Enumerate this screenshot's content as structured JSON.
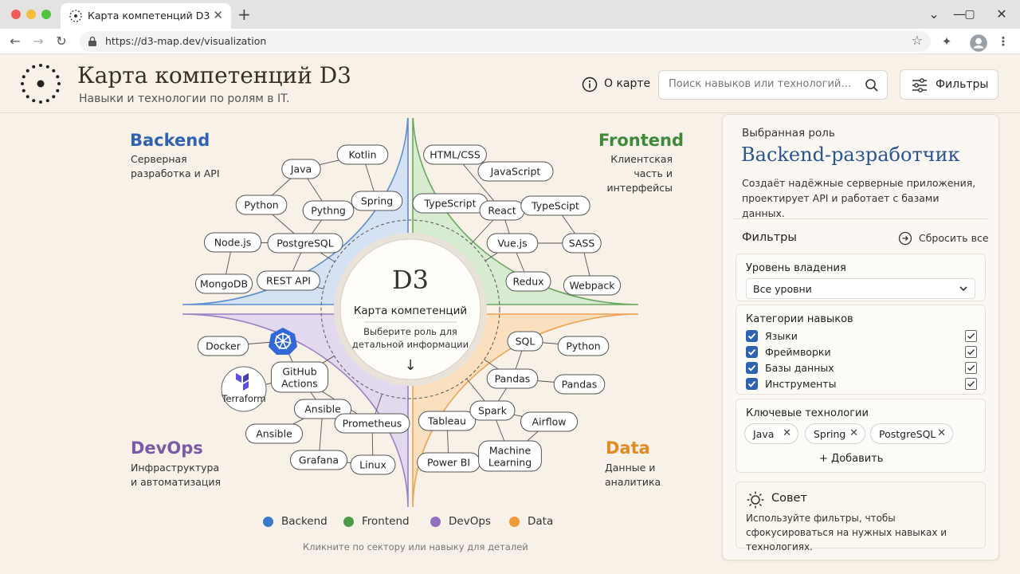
{
  "browser": {
    "tab_title": "Карта компетенций D3",
    "url": "https://d3-map.dev/visualization",
    "traffic_colors": [
      "#ee5d57",
      "#f6bd3a",
      "#52c33f"
    ]
  },
  "header": {
    "title": "Карта компетенций D3",
    "subtitle": "Навыки и технологии по ролям в IT.",
    "about_label": "О карте",
    "search_placeholder": "Поиск навыков или технологий…",
    "filters_label": "Фильтры"
  },
  "chart": {
    "center": {
      "title": "D3",
      "subtitle": "Карта компетенций",
      "hint": "Выберите роль для детальной информации",
      "arrow": "↓"
    },
    "sectors": [
      {
        "name": "Backend",
        "description": "Серверная разработка и API",
        "color": "#2f62b0"
      },
      {
        "name": "Frontend",
        "description": "Клиентская часть и интерфейсы",
        "color": "#3f8a3a"
      },
      {
        "name": "DevOps",
        "description": "Инфраструктура и автоматизация",
        "color": "#7a5aa6"
      },
      {
        "name": "Data",
        "description": "Данные и аналитика",
        "color": "#e08a25"
      }
    ],
    "nodes": {
      "backend": [
        "Kotlin",
        "Java",
        "Spring",
        "Python",
        "Pythng",
        "Node.js",
        "PostgreSQL",
        "MongoDB",
        "REST API"
      ],
      "frontend": [
        "HTML/CSS",
        "JavaScript",
        "TypeScript",
        "React",
        "TypeScipt",
        "Vue.js",
        "SASS",
        "Redux",
        "Webpack"
      ],
      "devops": [
        "Docker",
        "Kubernetes",
        "Terraform",
        "GitHub Actions",
        "Ansible",
        "Prometheus",
        "Ansible",
        "Grafana",
        "Linux"
      ],
      "data": [
        "SQL",
        "Python",
        "Pandas",
        "Pandas",
        "Tableau",
        "Spark",
        "Airflow",
        "Power BI",
        "Machine Learning"
      ]
    },
    "legend": [
      "Backend",
      "Frontend",
      "DevOps",
      "Data"
    ],
    "footer_hint": "Кликните по сектору или навыку для деталей"
  },
  "panel": {
    "selected_label": "Выбранная роль",
    "role_title": "Backend-разработчик",
    "role_description": "Создаёт надёжные серверные приложения, проектирует API и работает с базами данных.",
    "filters_heading": "Фильтры",
    "reset_label": "Сбросить все",
    "level_title": "Уровень владения",
    "level_value": "Все уровни",
    "categories_title": "Категории навыков",
    "categories": [
      "Языки",
      "Фреймворки",
      "Базы данных",
      "Инструменты"
    ],
    "tech_title": "Ключевые технологии",
    "tech_chips": [
      "Java",
      "Spring",
      "PostgreSQL"
    ],
    "add_label": "Добавить",
    "tip_title": "Совет",
    "tip_text": "Используйте фильтры, чтобы сфокусироваться на нужных навыках и технологиях."
  }
}
